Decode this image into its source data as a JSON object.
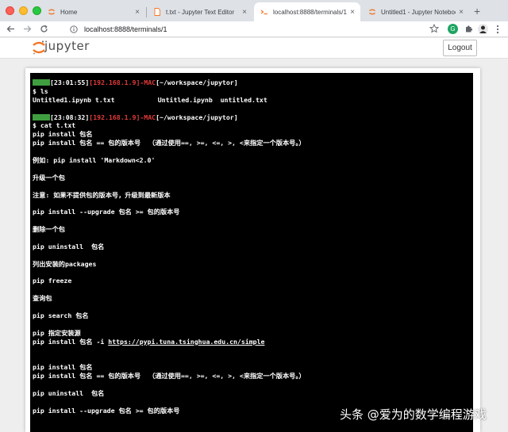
{
  "browser": {
    "tabs": [
      {
        "title": "Home",
        "icon": "jupyter-favicon-icon",
        "active": false
      },
      {
        "title": "t.txt - Jupyter Text Editor",
        "icon": "file-favicon-icon",
        "active": false
      },
      {
        "title": "localhost:8888/terminals/1",
        "icon": "terminal-favicon-icon",
        "active": true
      },
      {
        "title": "Untitled1 - Jupyter Notebook",
        "icon": "jupyter-favicon-icon",
        "active": false
      }
    ],
    "tab_close": "×",
    "new_tab": "+",
    "url": "localhost:8888/terminals/1"
  },
  "jupyter": {
    "logo_text": "jupyter",
    "logout_label": "Logout"
  },
  "terminal": {
    "prompt1": {
      "time": "[23:01:55]",
      "host": "[192.168.1.9]-MAC",
      "path": "[~/workspace/jupytor]"
    },
    "cmd1": "$ ls",
    "ls_output": "Untitled1.ipynb t.txt           Untitled.ipynb  untitled.txt",
    "prompt2": {
      "time": "[23:08:32]",
      "host": "[192.168.1.9]-MAC",
      "path": "[~/workspace/jupytor]"
    },
    "cmd2": "$ cat t.txt",
    "lines": [
      "pip install 包名",
      "pip install 包名 == 包的版本号  （通过使用==, >=, <=, >, <来指定一个版本号。）",
      "",
      "例如: pip install 'Markdown<2.0'",
      "",
      "升级一个包",
      "",
      "注意: 如果不提供包的版本号，升级到最新版本",
      "",
      "pip install --upgrade 包名 >= 包的版本号",
      "",
      "删除一个包",
      "",
      "pip uninstall  包名",
      "",
      "列出安装的packages",
      "",
      "pip freeze",
      "",
      "查询包",
      "",
      "pip search 包名",
      "",
      "pip 指定安装源"
    ],
    "mirror_prefix": "pip install 包名 -i",
    "mirror_url": "https://pypi.tuna.tsinghua.edu.cn/simple",
    "tail_lines": [
      "",
      "",
      "pip install 包名",
      "pip install 包名 == 包的版本号  （通过使用==, >=, <=, >, <来指定一个版本号。）",
      "",
      "pip uninstall  包名",
      "",
      "pip install --upgrade 包名 >= 包的版本号"
    ]
  },
  "watermark": "头条 @爱为的数学编程游戏",
  "colors": {
    "prompt_green": "#3f9e3f",
    "prompt_red": "#e23a3a",
    "terminal_bg": "#000000",
    "jupyter_orange": "#f37726"
  }
}
